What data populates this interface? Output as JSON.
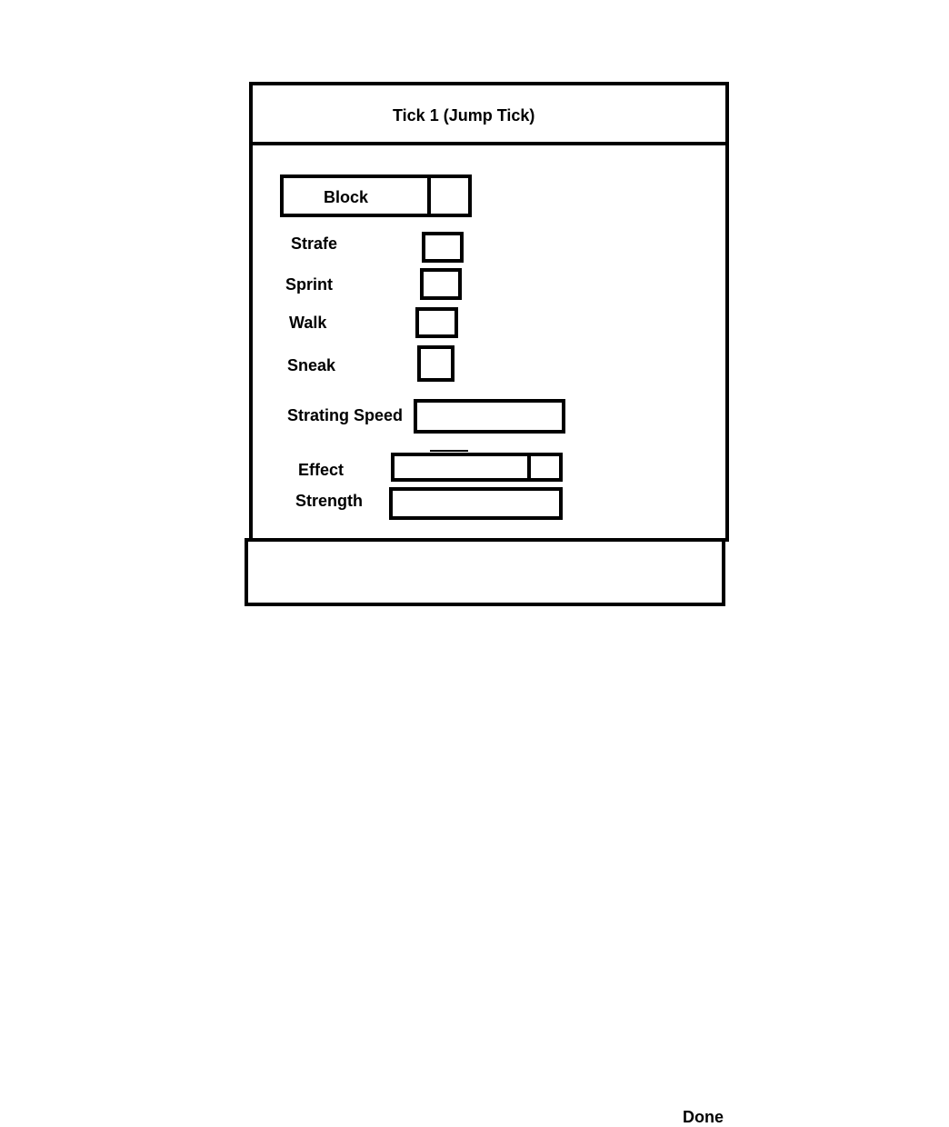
{
  "dialog": {
    "title": "Tick 1 (Jump Tick)",
    "done_label": "Done"
  },
  "block": {
    "label": "Block"
  },
  "checkboxes": [
    {
      "label": "Strafe"
    },
    {
      "label": "Sprint"
    },
    {
      "label": "Walk"
    },
    {
      "label": "Sneak"
    }
  ],
  "starting_speed": {
    "label": "Strating Speed",
    "value": ""
  },
  "effect": {
    "label": "Effect",
    "value": ""
  },
  "strength": {
    "label": "Strength",
    "value": ""
  }
}
